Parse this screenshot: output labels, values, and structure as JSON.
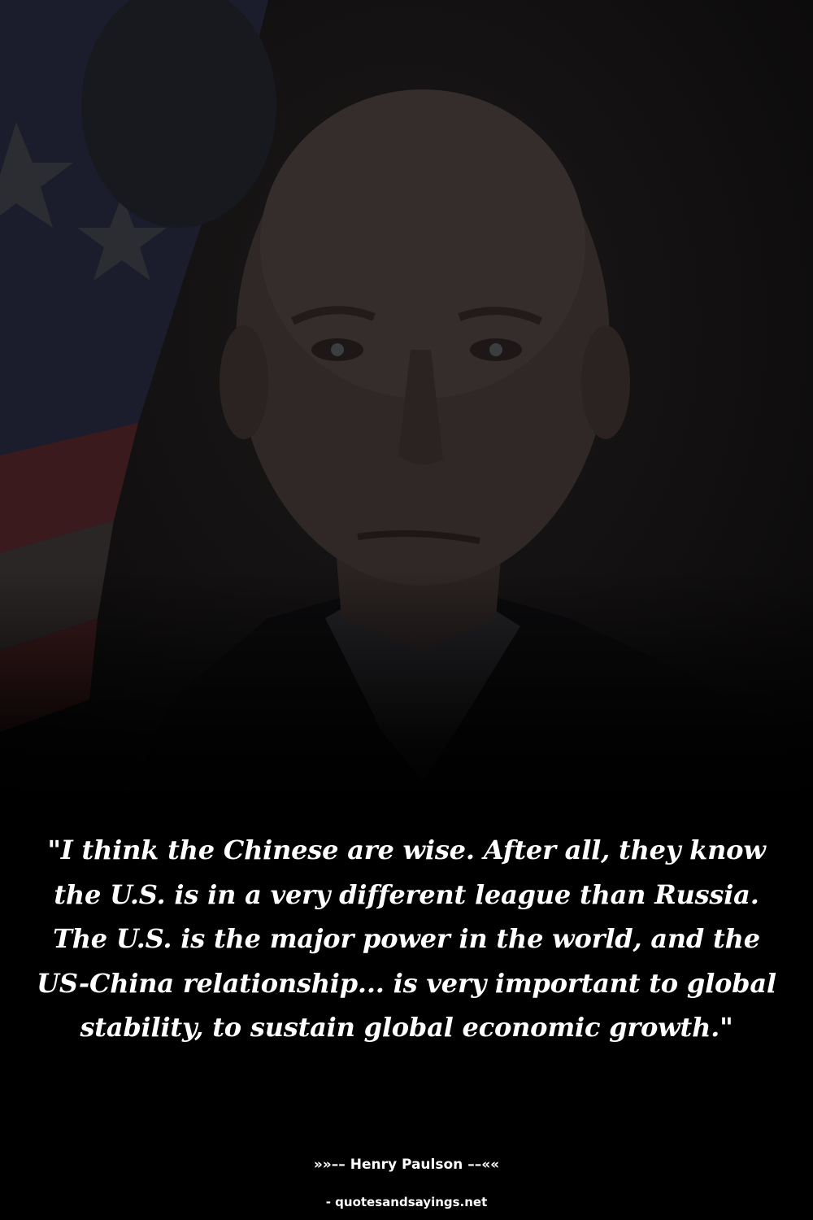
{
  "quote": {
    "text": "\"I think the Chinese are wise. After all, they know the U.S. is in a very different league than Russia. The U.S. is the major power in the world, and the US-China relationship... is very important to global stability, to sustain global economic growth.\""
  },
  "attribution": {
    "prefix": "»»––",
    "author": "Henry Paulson",
    "suffix": "––««"
  },
  "source": {
    "text": "- quotesandsayings.net"
  },
  "colors": {
    "background": "#000000",
    "text": "#ffffff"
  }
}
